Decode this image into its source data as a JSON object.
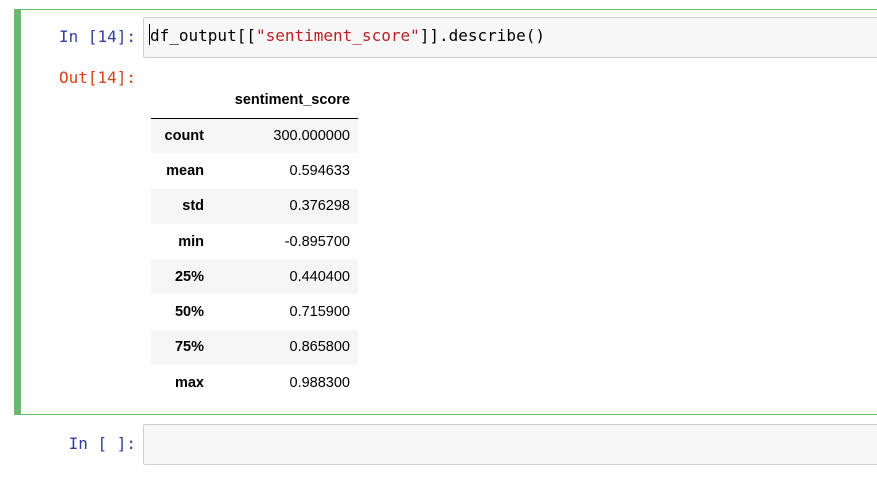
{
  "cell1": {
    "in_prompt": "In [14]:",
    "out_prompt": "Out[14]:",
    "code_prefix": "df_output[[",
    "code_string": "\"sentiment_score\"",
    "code_suffix": "]].describe()",
    "table": {
      "column": "sentiment_score",
      "rows": [
        {
          "stat": "count",
          "value": "300.000000"
        },
        {
          "stat": "mean",
          "value": "0.594633"
        },
        {
          "stat": "std",
          "value": "0.376298"
        },
        {
          "stat": "min",
          "value": "-0.895700"
        },
        {
          "stat": "25%",
          "value": "0.440400"
        },
        {
          "stat": "50%",
          "value": "0.715900"
        },
        {
          "stat": "75%",
          "value": "0.865800"
        },
        {
          "stat": "max",
          "value": "0.988300"
        }
      ]
    }
  },
  "cell2": {
    "in_prompt": "In [ ]:",
    "code": ""
  },
  "colors": {
    "selected_border": "#66bb6a",
    "in_prompt": "#303f9f",
    "out_prompt": "#d84315",
    "string": "#ba2121"
  }
}
